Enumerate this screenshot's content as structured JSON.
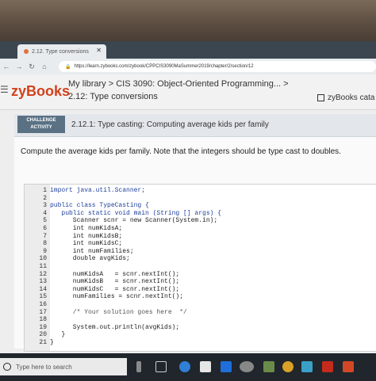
{
  "browser": {
    "tab_title": "2.12. Type conversions",
    "url": "https://learn.zybooks.com/zybook/CPPCIS3090MaSummer2019/chapter/2/section/12"
  },
  "header": {
    "logo": "zyBooks",
    "breadcrumb": "My library > CIS 3090: Object-Oriented Programming... >",
    "section": "2.12: Type conversions",
    "catalog": "zyBooks cata"
  },
  "challenge": {
    "badge_line1": "CHALLENGE",
    "badge_line2": "ACTIVITY",
    "title": "2.12.1: Type casting: Computing average kids per family",
    "prompt": "Compute the average kids per family. Note that the integers should be type cast to doubles."
  },
  "code_lines": [
    {
      "n": "1",
      "t": "import java.util.Scanner;"
    },
    {
      "n": "2",
      "t": ""
    },
    {
      "n": "3",
      "t": "public class TypeCasting {"
    },
    {
      "n": "4",
      "t": "   public static void main (String [] args) {"
    },
    {
      "n": "5",
      "t": "      Scanner scnr = new Scanner(System.in);"
    },
    {
      "n": "6",
      "t": "      int numKidsA;"
    },
    {
      "n": "7",
      "t": "      int numKidsB;"
    },
    {
      "n": "8",
      "t": "      int numKidsC;"
    },
    {
      "n": "9",
      "t": "      int numFamilies;"
    },
    {
      "n": "10",
      "t": "      double avgKids;"
    },
    {
      "n": "11",
      "t": ""
    },
    {
      "n": "12",
      "t": "      numKidsA   = scnr.nextInt();"
    },
    {
      "n": "13",
      "t": "      numKidsB   = scnr.nextInt();"
    },
    {
      "n": "14",
      "t": "      numKidsC   = scnr.nextInt();"
    },
    {
      "n": "15",
      "t": "      numFamilies = scnr.nextInt();"
    },
    {
      "n": "16",
      "t": ""
    },
    {
      "n": "17",
      "t": "      /* Your solution goes here  */"
    },
    {
      "n": "18",
      "t": ""
    },
    {
      "n": "19",
      "t": "      System.out.println(avgKids);"
    },
    {
      "n": "20",
      "t": "   }"
    },
    {
      "n": "21",
      "t": "}"
    }
  ],
  "taskbar": {
    "search_placeholder": "Type here to search"
  }
}
